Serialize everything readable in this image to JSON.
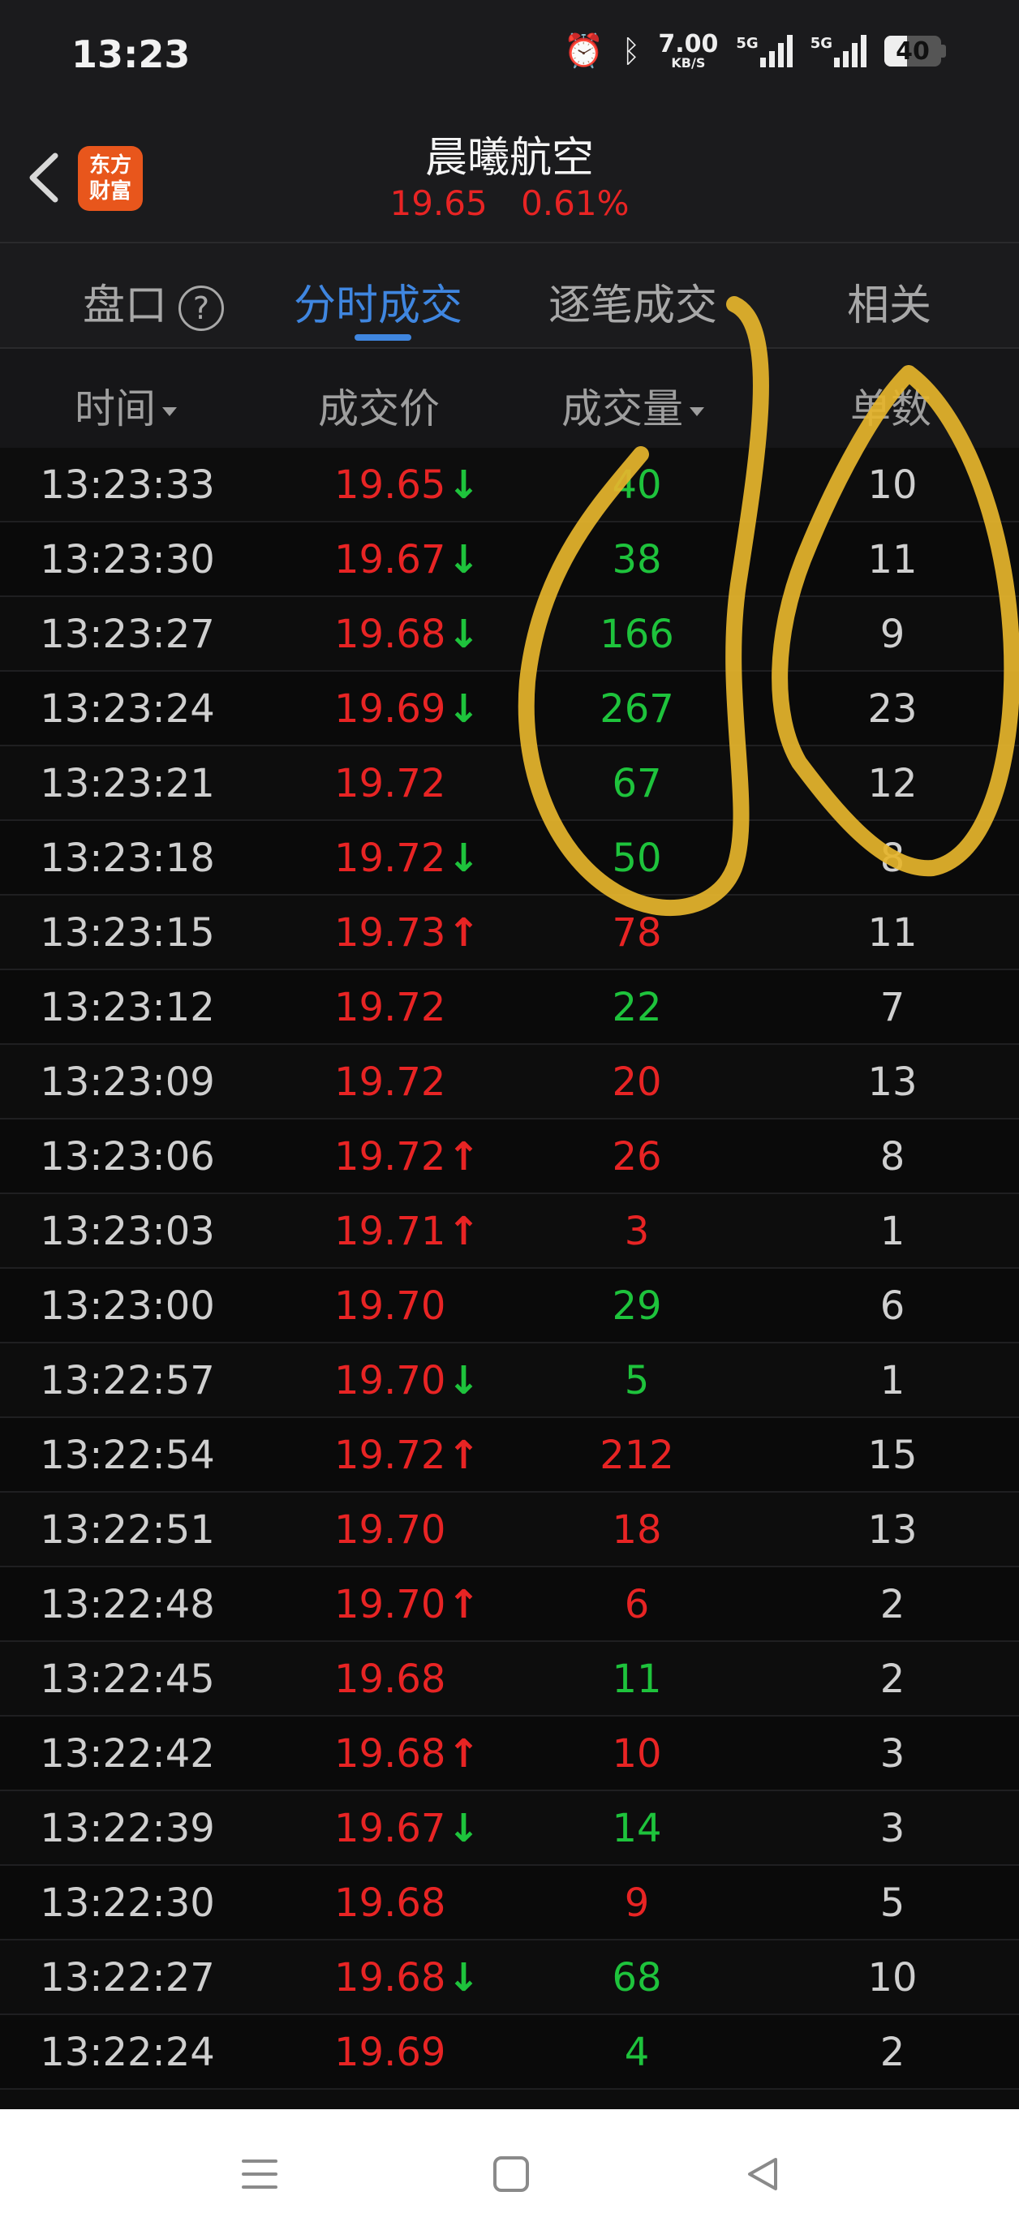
{
  "status_bar": {
    "time": "13:23",
    "net_speed": "7.00",
    "net_unit": "KB/S",
    "sim1_tag": "5G",
    "sim2_tag": "5G",
    "battery": "40"
  },
  "header": {
    "logo_line1": "东方",
    "logo_line2": "财富",
    "title": "晨曦航空",
    "price": "19.65",
    "change_pct": "0.61%"
  },
  "tabs": [
    {
      "label": "盘口"
    },
    {
      "label": "分时成交"
    },
    {
      "label": "逐笔成交"
    },
    {
      "label": "相关"
    }
  ],
  "columns": {
    "time": "时间",
    "price": "成交价",
    "volume": "成交量",
    "count": "单数"
  },
  "colors": {
    "up": "#e82424",
    "down": "#1ec33c",
    "accent": "#3f86e0",
    "annotation": "#e6b52c"
  },
  "trades": [
    {
      "time": "13:23:33",
      "price": "19.65",
      "arrow": "↓",
      "vol": "40",
      "vol_dir": "down",
      "count": "10"
    },
    {
      "time": "13:23:30",
      "price": "19.67",
      "arrow": "↓",
      "vol": "38",
      "vol_dir": "down",
      "count": "11"
    },
    {
      "time": "13:23:27",
      "price": "19.68",
      "arrow": "↓",
      "vol": "166",
      "vol_dir": "down",
      "count": "9"
    },
    {
      "time": "13:23:24",
      "price": "19.69",
      "arrow": "↓",
      "vol": "267",
      "vol_dir": "down",
      "count": "23"
    },
    {
      "time": "13:23:21",
      "price": "19.72",
      "arrow": "",
      "vol": "67",
      "vol_dir": "down",
      "count": "12"
    },
    {
      "time": "13:23:18",
      "price": "19.72",
      "arrow": "↓",
      "vol": "50",
      "vol_dir": "down",
      "count": "8"
    },
    {
      "time": "13:23:15",
      "price": "19.73",
      "arrow": "↑",
      "vol": "78",
      "vol_dir": "up",
      "count": "11"
    },
    {
      "time": "13:23:12",
      "price": "19.72",
      "arrow": "",
      "vol": "22",
      "vol_dir": "down",
      "count": "7"
    },
    {
      "time": "13:23:09",
      "price": "19.72",
      "arrow": "",
      "vol": "20",
      "vol_dir": "up",
      "count": "13"
    },
    {
      "time": "13:23:06",
      "price": "19.72",
      "arrow": "↑",
      "vol": "26",
      "vol_dir": "up",
      "count": "8"
    },
    {
      "time": "13:23:03",
      "price": "19.71",
      "arrow": "↑",
      "vol": "3",
      "vol_dir": "up",
      "count": "1"
    },
    {
      "time": "13:23:00",
      "price": "19.70",
      "arrow": "",
      "vol": "29",
      "vol_dir": "down",
      "count": "6"
    },
    {
      "time": "13:22:57",
      "price": "19.70",
      "arrow": "↓",
      "vol": "5",
      "vol_dir": "down",
      "count": "1"
    },
    {
      "time": "13:22:54",
      "price": "19.72",
      "arrow": "↑",
      "vol": "212",
      "vol_dir": "up",
      "count": "15"
    },
    {
      "time": "13:22:51",
      "price": "19.70",
      "arrow": "",
      "vol": "18",
      "vol_dir": "up",
      "count": "13"
    },
    {
      "time": "13:22:48",
      "price": "19.70",
      "arrow": "↑",
      "vol": "6",
      "vol_dir": "up",
      "count": "2"
    },
    {
      "time": "13:22:45",
      "price": "19.68",
      "arrow": "",
      "vol": "11",
      "vol_dir": "down",
      "count": "2"
    },
    {
      "time": "13:22:42",
      "price": "19.68",
      "arrow": "↑",
      "vol": "10",
      "vol_dir": "up",
      "count": "3"
    },
    {
      "time": "13:22:39",
      "price": "19.67",
      "arrow": "↓",
      "vol": "14",
      "vol_dir": "down",
      "count": "3"
    },
    {
      "time": "13:22:30",
      "price": "19.68",
      "arrow": "",
      "vol": "9",
      "vol_dir": "up",
      "count": "5"
    },
    {
      "time": "13:22:27",
      "price": "19.68",
      "arrow": "↓",
      "vol": "68",
      "vol_dir": "down",
      "count": "10"
    },
    {
      "time": "13:22:24",
      "price": "19.69",
      "arrow": "",
      "vol": "4",
      "vol_dir": "down",
      "count": "2"
    }
  ],
  "nav": {
    "menu_icon": "menu-icon",
    "home_icon": "home-icon",
    "back_icon": "back-triangle-icon"
  }
}
